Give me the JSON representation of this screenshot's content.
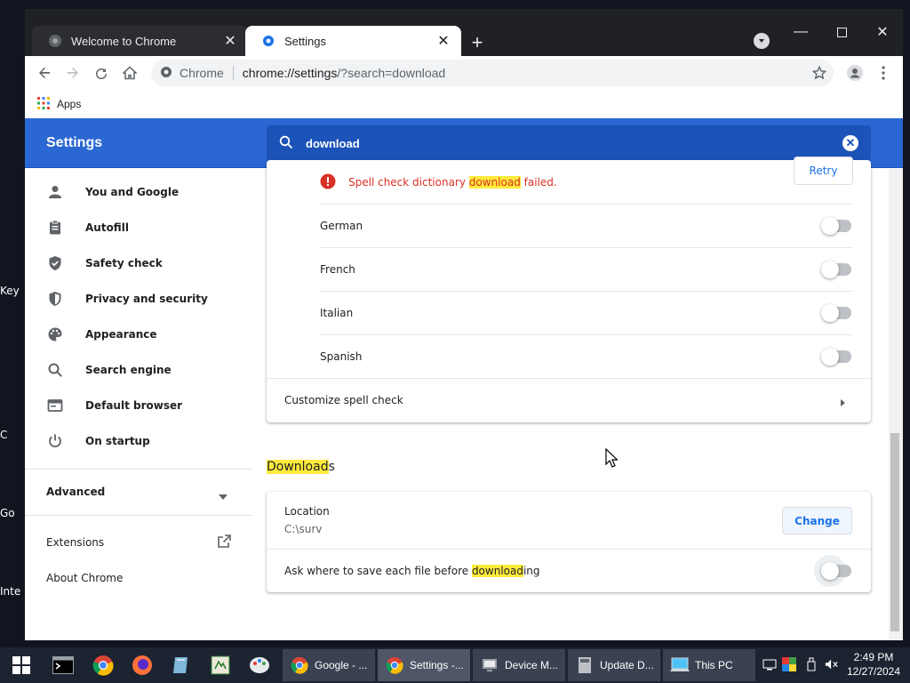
{
  "desktop": {
    "side_labels": [
      "Key",
      "C",
      "Go",
      "Inte"
    ]
  },
  "tabs": [
    {
      "label": "Welcome to Chrome",
      "icon": "chrome-favicon"
    },
    {
      "label": "Settings",
      "icon": "settings-gear-icon"
    }
  ],
  "toolbar": {
    "site_label": "Chrome",
    "url_host": "chrome://settings",
    "url_rest": "/?search=download"
  },
  "bookmarks": {
    "apps_label": "Apps"
  },
  "settings": {
    "title": "Settings",
    "search_value": "download"
  },
  "sidebar": {
    "items": [
      {
        "label": "You and Google",
        "icon": "person-icon"
      },
      {
        "label": "Autofill",
        "icon": "clipboard-icon"
      },
      {
        "label": "Safety check",
        "icon": "shield-check-icon"
      },
      {
        "label": "Privacy and security",
        "icon": "shield-icon"
      },
      {
        "label": "Appearance",
        "icon": "palette-icon"
      },
      {
        "label": "Search engine",
        "icon": "search-icon"
      },
      {
        "label": "Default browser",
        "icon": "browser-icon"
      },
      {
        "label": "On startup",
        "icon": "power-icon"
      }
    ],
    "advanced": "Advanced",
    "extensions": "Extensions",
    "about": "About Chrome"
  },
  "spellcheck": {
    "error_pre": "Spell check dictionary ",
    "error_hl": "download",
    "error_post": " failed.",
    "retry_label": "Retry",
    "languages": [
      "German",
      "French",
      "Italian",
      "Spanish"
    ],
    "customize_label": "Customize spell check"
  },
  "downloads": {
    "section_hl": "Download",
    "section_rest": "s",
    "location_label": "Location",
    "location_value": "C:\\surv",
    "change_label": "Change",
    "ask_pre": "Ask where to save each file before ",
    "ask_hl": "download",
    "ask_post": "ing"
  },
  "taskbar": {
    "apps": [
      {
        "label": "Google - ...",
        "icon": "chrome-icon"
      },
      {
        "label": "Settings -...",
        "icon": "chrome-icon"
      },
      {
        "label": "Device M...",
        "icon": "device-manager-icon"
      },
      {
        "label": "Update D...",
        "icon": "update-icon"
      },
      {
        "label": "This PC",
        "icon": "this-pc-icon"
      }
    ],
    "time": "2:49 PM",
    "date": "12/27/2024"
  },
  "colors": {
    "header_blue": "#2a67d3",
    "error_red": "#d93025",
    "link_blue": "#1a73e8",
    "highlight": "#ffeb3b"
  }
}
